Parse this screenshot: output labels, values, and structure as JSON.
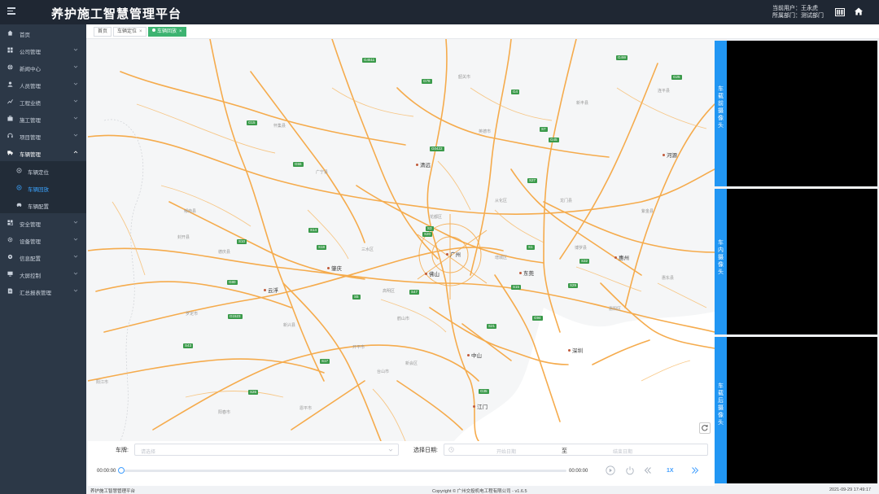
{
  "header": {
    "title": "养护施工智慧管理平台",
    "current_user_label": "当前用户：",
    "current_user": "王永虎",
    "department_label": "所属部门：",
    "department": "测试部门"
  },
  "sidebar": {
    "items": [
      {
        "label": "首页",
        "icon": "home-icon",
        "has_children": false
      },
      {
        "label": "公司管理",
        "icon": "grid-icon",
        "has_children": true
      },
      {
        "label": "新闻中心",
        "icon": "globe-icon",
        "has_children": true
      },
      {
        "label": "人员管理",
        "icon": "user-icon",
        "has_children": true
      },
      {
        "label": "工程业绩",
        "icon": "chart-icon",
        "has_children": true
      },
      {
        "label": "施工管理",
        "icon": "briefcase-icon",
        "has_children": true
      },
      {
        "label": "项目管理",
        "icon": "headset-icon",
        "has_children": true
      },
      {
        "label": "车辆管理",
        "icon": "truck-icon",
        "has_children": true,
        "expanded": true
      },
      {
        "label": "安全管理",
        "icon": "shield-icon",
        "has_children": true
      },
      {
        "label": "设备管理",
        "icon": "gear-icon",
        "has_children": true
      },
      {
        "label": "信息配置",
        "icon": "settings-icon",
        "has_children": true
      },
      {
        "label": "大屏控制",
        "icon": "monitor-icon",
        "has_children": true
      },
      {
        "label": "汇总报表管理",
        "icon": "report-icon",
        "has_children": true
      }
    ],
    "sub_items": [
      {
        "label": "车辆定位",
        "icon": "location-icon"
      },
      {
        "label": "车辆回放",
        "icon": "playback-icon",
        "active": true
      },
      {
        "label": "车辆配置",
        "icon": "car-icon"
      }
    ]
  },
  "tabs": [
    {
      "label": "首页"
    },
    {
      "label": "车辆定位",
      "close": "×"
    },
    {
      "label": "车辆回放",
      "close": "×",
      "active": true
    }
  ],
  "map": {
    "cities": [
      {
        "name": "清远"
      },
      {
        "name": "广州"
      },
      {
        "name": "佛山"
      },
      {
        "name": "东莞"
      },
      {
        "name": "惠州"
      },
      {
        "name": "肇庆"
      },
      {
        "name": "云浮"
      },
      {
        "name": "中山"
      },
      {
        "name": "深圳"
      },
      {
        "name": "江门"
      },
      {
        "name": "河源"
      }
    ],
    "towns": [
      "韶关市",
      "英德市",
      "新丰县",
      "连平县",
      "怀集县",
      "广宁县",
      "封开县",
      "德庆县",
      "罗定市",
      "新兴县",
      "鹤山市",
      "台山市",
      "恩平市",
      "阳春市",
      "博罗县",
      "龙门县",
      "从化区",
      "增城区",
      "花都区",
      "三水区",
      "高明区",
      "新会区",
      "惠阳区",
      "惠东县",
      "紫金县",
      "郁南县",
      "阳江市",
      "开平市"
    ],
    "highways": [
      "G4",
      "G45",
      "G94",
      "G15",
      "G55",
      "G78",
      "G80",
      "G25",
      "G35",
      "S5",
      "S14",
      "S7",
      "S1",
      "S20",
      "S32",
      "S47",
      "S3",
      "S21",
      "G4511",
      "G0422",
      "G1523",
      "S15",
      "S29",
      "S27",
      "S10",
      "S17",
      "S18",
      "S26",
      "S43",
      "G4W"
    ]
  },
  "cameras": [
    {
      "label": "车载前摄像头"
    },
    {
      "label": "车内摄像头"
    },
    {
      "label": "车载后摄像头"
    }
  ],
  "controls": {
    "plate_label": "车牌:",
    "plate_placeholder": "请选择",
    "date_label": "选择日期:",
    "start_placeholder": "开始日期",
    "separator": "至",
    "end_placeholder": "结束日期",
    "time_start": "00:00:00",
    "time_end": "00:00:00",
    "progress": 0,
    "speed": "1X"
  },
  "footer": {
    "left": "养护施工智慧管理平台",
    "center": "Copyright © 广州交投机电工程有限公司 - v1.6.5",
    "right": "2021-09-29 17:49:17"
  },
  "colors": {
    "header_bg": "#1f2733",
    "sidebar_bg": "#2c3847",
    "accent": "#2196f3",
    "active_tab": "#3cb371",
    "road": "#f5a33a"
  }
}
